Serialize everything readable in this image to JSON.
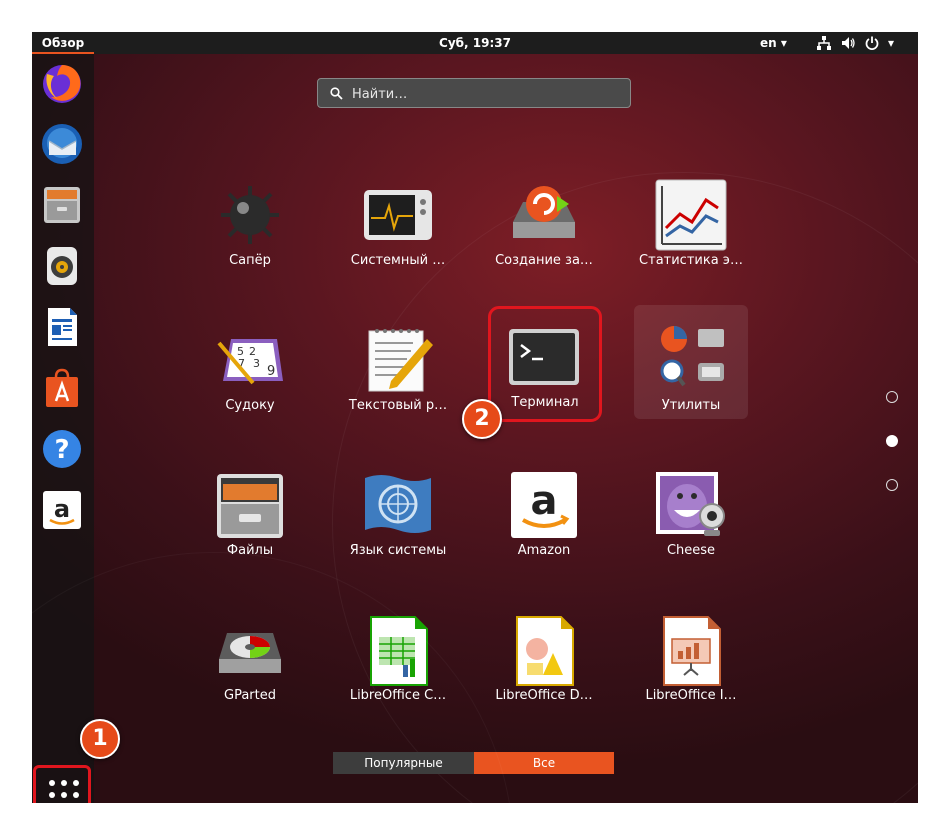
{
  "topbar": {
    "activities": "Обзор",
    "clock": "Суб, 19:37",
    "language": "en",
    "icons": [
      "network-icon",
      "volume-icon",
      "power-icon"
    ]
  },
  "dock": {
    "items": [
      {
        "name": "firefox",
        "icon": "firefox-icon"
      },
      {
        "name": "thunderbird",
        "icon": "mail-icon"
      },
      {
        "name": "files",
        "icon": "file-cabinet-icon"
      },
      {
        "name": "rhythmbox",
        "icon": "speaker-icon"
      },
      {
        "name": "libreoffice-writer",
        "icon": "document-icon"
      },
      {
        "name": "software",
        "icon": "shopping-bag-icon"
      },
      {
        "name": "help",
        "icon": "question-icon"
      },
      {
        "name": "amazon",
        "icon": "amazon-icon"
      }
    ],
    "show_apps_icon": "grid-dots-icon"
  },
  "search": {
    "placeholder": "Найти…"
  },
  "apps": [
    {
      "label": "Сапёр",
      "icon": "mine-icon"
    },
    {
      "label": "Системный …",
      "icon": "system-monitor-icon"
    },
    {
      "label": "Создание за…",
      "icon": "backup-icon"
    },
    {
      "label": "Статистика э…",
      "icon": "power-statistics-icon"
    },
    {
      "label": "Судоку",
      "icon": "sudoku-icon"
    },
    {
      "label": "Текстовый р…",
      "icon": "text-editor-icon"
    },
    {
      "label": "Терминал",
      "icon": "terminal-icon"
    },
    {
      "label": "Утилиты",
      "icon": "utilities-folder-icon"
    },
    {
      "label": "Файлы",
      "icon": "file-cabinet-icon"
    },
    {
      "label": "Язык системы",
      "icon": "language-flag-icon"
    },
    {
      "label": "Amazon",
      "icon": "amazon-icon"
    },
    {
      "label": "Cheese",
      "icon": "cheese-webcam-icon"
    },
    {
      "label": "GParted",
      "icon": "disk-partition-icon"
    },
    {
      "label": "LibreOffice C…",
      "icon": "spreadsheet-icon"
    },
    {
      "label": "LibreOffice D…",
      "icon": "draw-icon"
    },
    {
      "label": "LibreOffice I…",
      "icon": "presentation-icon"
    }
  ],
  "pages": {
    "count": 3,
    "active": 2
  },
  "tabs": {
    "popular": "Популярные",
    "all": "Все",
    "active": "all"
  },
  "annotations": {
    "badge1": "1",
    "badge2": "2",
    "color": "#e0161e"
  },
  "colors": {
    "accent": "#e95420",
    "topbar": "#1d1d1d"
  }
}
